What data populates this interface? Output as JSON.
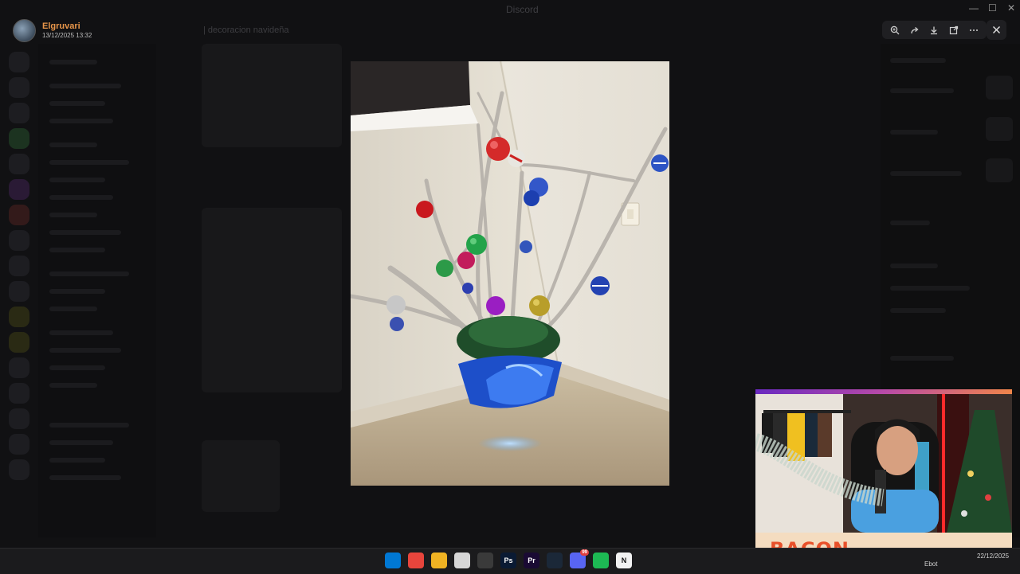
{
  "window": {
    "title": "Discord"
  },
  "channel": {
    "name": "| decoracion navideña"
  },
  "viewer": {
    "uploader_name": "Elgruvari",
    "upload_date": "13/12/2025 13:32",
    "toolbar": [
      {
        "name": "zoom-in-icon",
        "label": "Zoom"
      },
      {
        "name": "forward-icon",
        "label": "Forward"
      },
      {
        "name": "download-icon",
        "label": "Download"
      },
      {
        "name": "open-in-browser-icon",
        "label": "Open in browser"
      },
      {
        "name": "more-icon",
        "label": "More"
      }
    ],
    "close_label": "Close"
  },
  "overlay": {
    "banner_text": "BACON"
  },
  "taskbar": {
    "apps": [
      {
        "name": "windows-start-icon",
        "glyph": "",
        "color": "#0078d4"
      },
      {
        "name": "chrome-icon",
        "glyph": "",
        "color": "#e8453c"
      },
      {
        "name": "file-explorer-icon",
        "glyph": "",
        "color": "#f0b323"
      },
      {
        "name": "snipping-tool-icon",
        "glyph": "",
        "color": "#d6d6d6"
      },
      {
        "name": "obs-icon",
        "glyph": "",
        "color": "#3a3a3a"
      },
      {
        "name": "photoshop-icon",
        "glyph": "Ps",
        "color": "#0a1a33"
      },
      {
        "name": "premiere-icon",
        "glyph": "Pr",
        "color": "#1a0a33"
      },
      {
        "name": "steam-icon",
        "glyph": "",
        "color": "#1b2838"
      },
      {
        "name": "discord-icon",
        "glyph": "",
        "color": "#5865f2",
        "badge": "99"
      },
      {
        "name": "spotify-icon",
        "glyph": "",
        "color": "#1db954"
      },
      {
        "name": "notion-icon",
        "glyph": "N",
        "color": "#f2f2f2"
      }
    ],
    "tray_left": "Ebot",
    "tray_date": "22/12/2025"
  },
  "colors": {
    "accent": "#e8964a",
    "banner": "#e8502a"
  }
}
